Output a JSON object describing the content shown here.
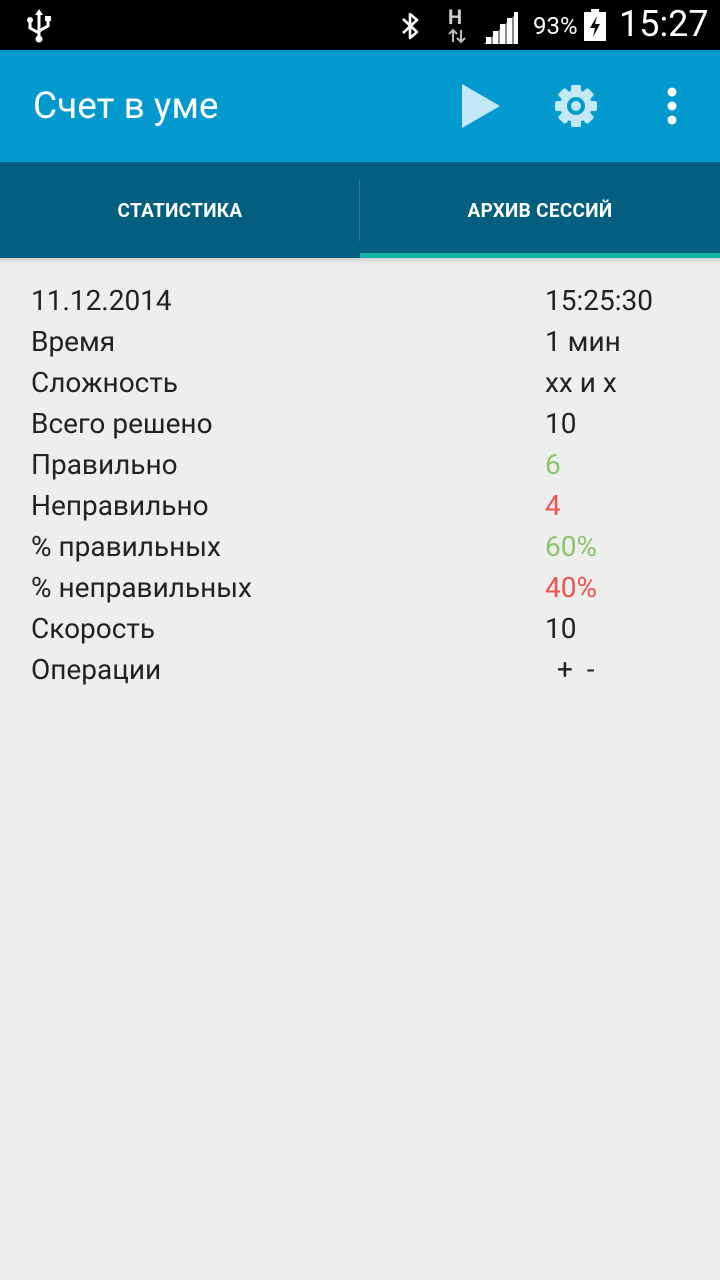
{
  "status_bar": {
    "battery_percent": "93%",
    "time": "15:27",
    "network_type": "H",
    "icons": [
      "usb-icon",
      "bluetooth-icon",
      "network-h-icon",
      "signal-icon",
      "battery-charging-icon"
    ]
  },
  "app_bar": {
    "title": "Счет в уме",
    "actions": [
      "play-icon",
      "gear-icon",
      "more-vert-icon"
    ]
  },
  "tabs": [
    {
      "label": "СТАТИСТИКА",
      "selected": false
    },
    {
      "label": "АРХИВ СЕССИЙ",
      "selected": true
    }
  ],
  "session": {
    "date": "11.12.2014",
    "time": "15:25:30",
    "rows": [
      {
        "label": "Время",
        "value": "1 мин"
      },
      {
        "label": "Сложность",
        "value": "xx и x"
      },
      {
        "label": "Всего решено",
        "value": "10"
      },
      {
        "label": "Правильно",
        "value": "6"
      },
      {
        "label": "Неправильно",
        "value": "4"
      },
      {
        "label": "% правильных",
        "value": "60%"
      },
      {
        "label": "% неправильных",
        "value": "40%"
      },
      {
        "label": "Скорость",
        "value": "10"
      },
      {
        "label": "Операции",
        "value": "+  -"
      }
    ]
  },
  "colors": {
    "app_bar": "#0299cf",
    "tabs": "#035f80",
    "tab_indicator": "#14b2a8",
    "correct": "#8bc56a",
    "incorrect": "#f0524f",
    "background": "#eeeeee"
  }
}
